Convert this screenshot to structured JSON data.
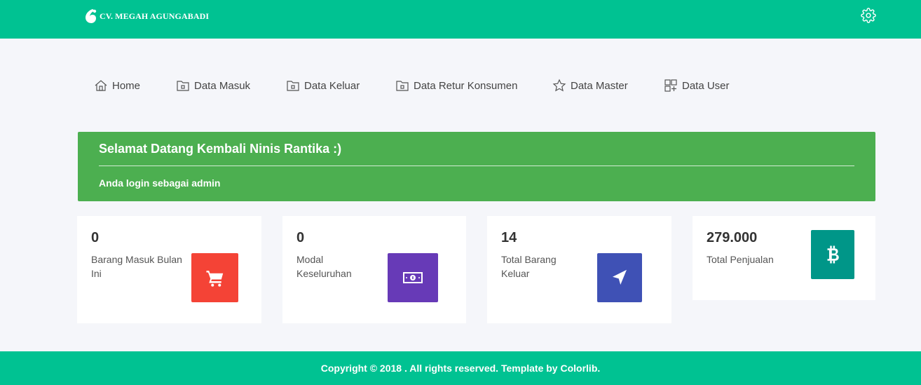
{
  "brand": {
    "name": "CV. MEGAH AGUNGABADI",
    "logo_icon": "leaf-logo-icon"
  },
  "header": {
    "settings_icon": "gear-icon"
  },
  "nav": {
    "items": [
      {
        "label": "Home",
        "icon": "home-icon"
      },
      {
        "label": "Data Masuk",
        "icon": "folder-icon"
      },
      {
        "label": "Data Keluar",
        "icon": "folder-icon"
      },
      {
        "label": "Data Retur Konsumen",
        "icon": "folder-icon"
      },
      {
        "label": "Data Master",
        "icon": "star-icon"
      },
      {
        "label": "Data User",
        "icon": "grid-add-icon"
      }
    ]
  },
  "welcome": {
    "title": "Selamat Datang Kembali Ninis Rantika :)",
    "subtitle": "Anda login sebagai admin",
    "color": "#4caf50"
  },
  "stats": [
    {
      "value": "0",
      "label": "Barang Masuk Bulan Ini",
      "icon": "cart-icon",
      "color": "#f44336"
    },
    {
      "value": "0",
      "label": "Modal Keseluruhan",
      "icon": "money-icon",
      "color": "#673ab7"
    },
    {
      "value": "14",
      "label": "Total Barang Keluar",
      "icon": "navigation-arrow-icon",
      "color": "#3f51b5"
    },
    {
      "value": "279.000",
      "label": "Total Penjualan",
      "icon": "bitcoin-icon",
      "color": "#009688"
    }
  ],
  "footer": {
    "text": "Copyright © 2018 . All rights reserved. Template by ",
    "link": "Colorlib",
    "end": "."
  },
  "colors": {
    "primary": "#00c292",
    "background": "#f5f6fa"
  }
}
